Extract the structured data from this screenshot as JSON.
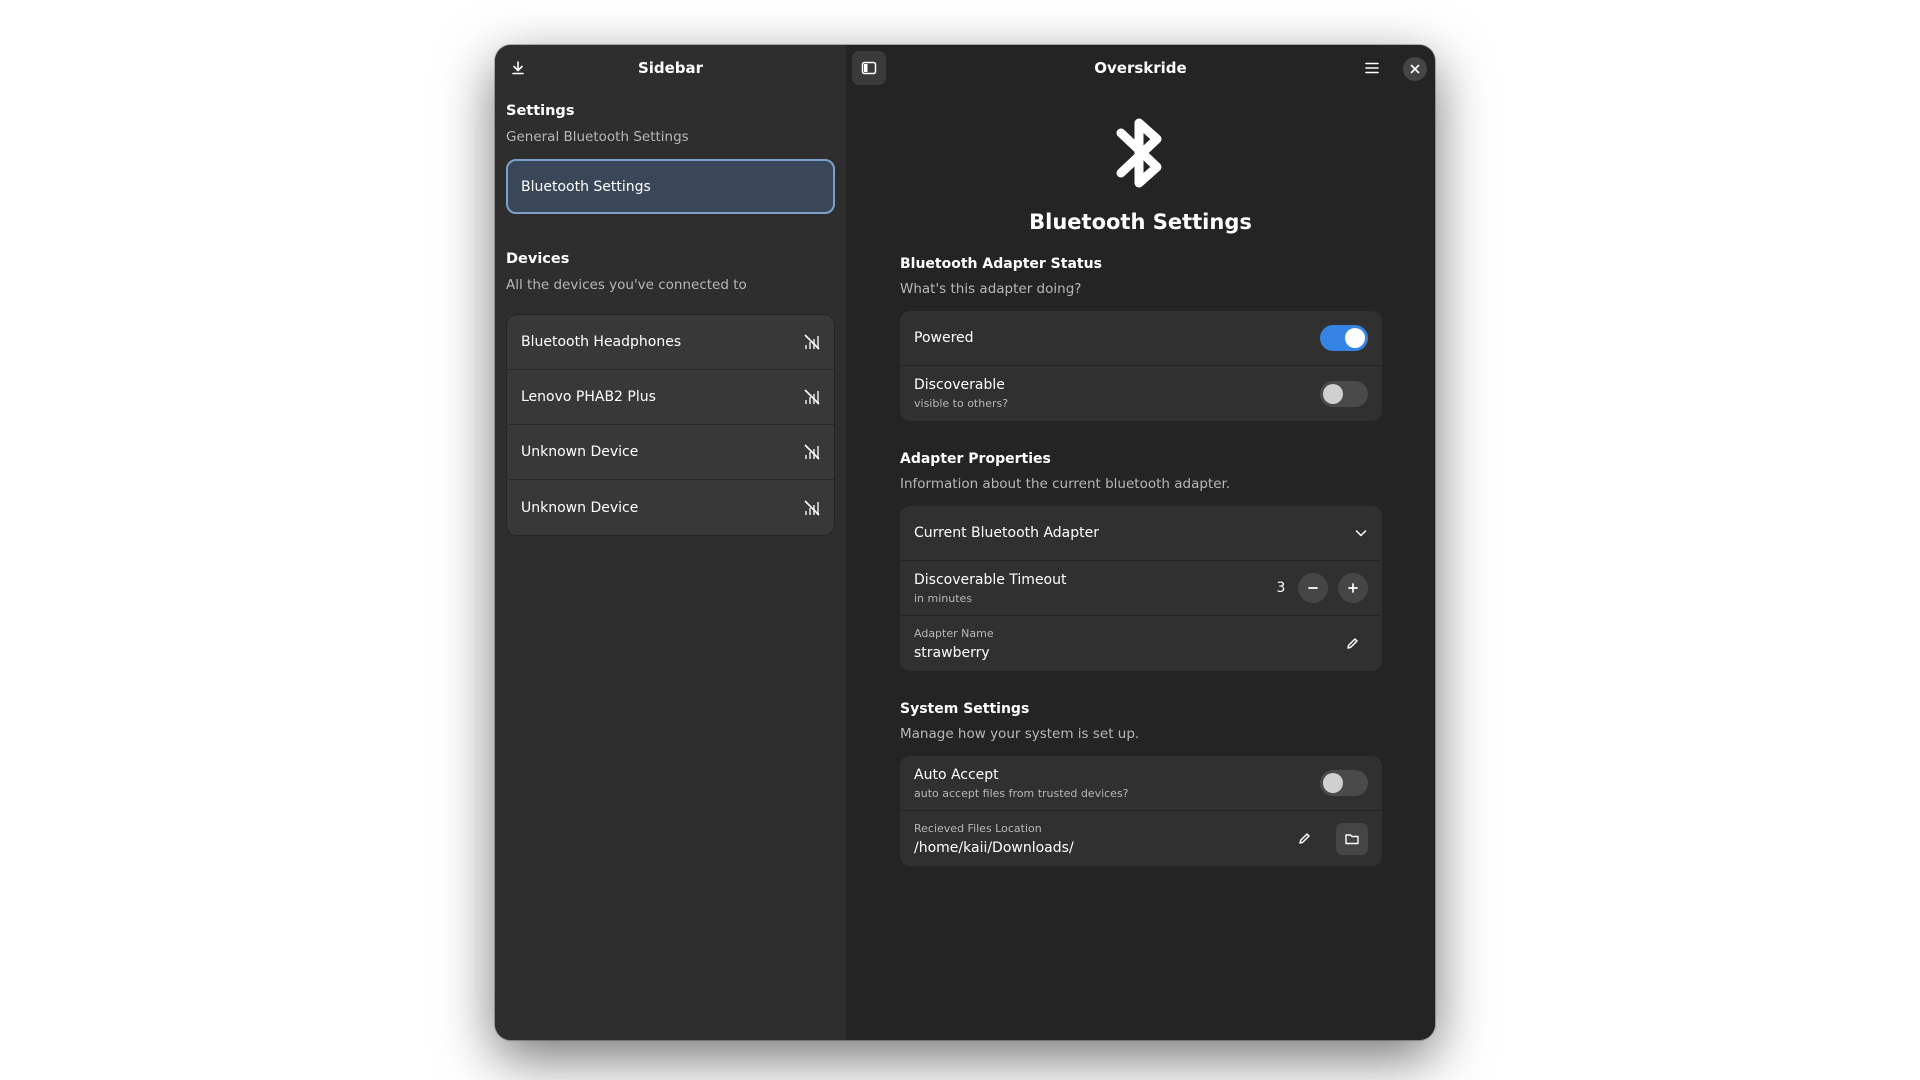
{
  "sidebar": {
    "title": "Sidebar",
    "settings_title": "Settings",
    "settings_subtitle": "General Bluetooth Settings",
    "settings_item": "Bluetooth Settings",
    "devices_title": "Devices",
    "devices_subtitle": "All the devices you've connected to",
    "devices": [
      {
        "name": "Bluetooth Headphones"
      },
      {
        "name": "Lenovo PHAB2 Plus"
      },
      {
        "name": "Unknown Device"
      },
      {
        "name": "Unknown Device"
      }
    ]
  },
  "header": {
    "title": "Overskride"
  },
  "hero": {
    "title": "Bluetooth Settings"
  },
  "adapter_status": {
    "title": "Bluetooth Adapter Status",
    "subtitle": "What's this adapter doing?",
    "powered_label": "Powered",
    "powered_on": true,
    "discoverable_label": "Discoverable",
    "discoverable_sub": "visible to others?",
    "discoverable_on": false
  },
  "adapter_props": {
    "title": "Adapter Properties",
    "subtitle": "Information about the current bluetooth adapter.",
    "current_adapter_label": "Current Bluetooth Adapter",
    "timeout_label": "Discoverable Timeout",
    "timeout_sub": "in minutes",
    "timeout_value": "3",
    "name_label": "Adapter Name",
    "name_value": "strawberry"
  },
  "system": {
    "title": "System Settings",
    "subtitle": "Manage how your system is set up.",
    "auto_accept_label": "Auto Accept",
    "auto_accept_sub": "auto accept files from trusted devices?",
    "auto_accept_on": false,
    "files_label": "Recieved Files Location",
    "files_value": "/home/kaii/Downloads/"
  },
  "colors": {
    "accent": "#3584e4",
    "selected_bg": "#3a4758",
    "selected_border": "#7d9fcc"
  }
}
